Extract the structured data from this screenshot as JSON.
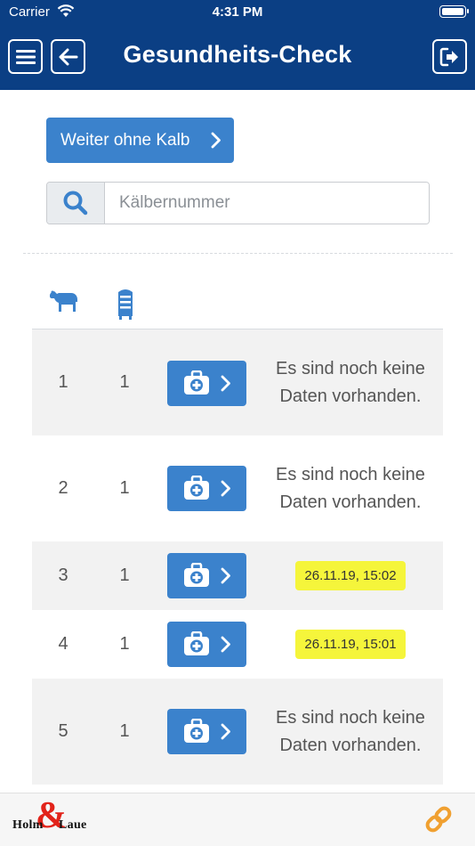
{
  "status_bar": {
    "carrier": "Carrier",
    "time": "4:31 PM"
  },
  "header": {
    "title": "Gesundheits-Check",
    "menu_icon": "hamburger-menu-icon",
    "back_icon": "arrow-left-icon",
    "logout_icon": "sign-out-icon"
  },
  "content": {
    "skip_button_label": "Weiter ohne Kalb",
    "search": {
      "placeholder": "Kälbernummer",
      "value": "",
      "icon": "search-icon"
    },
    "column_icons": [
      "cow-icon",
      "milk-tank-icon"
    ]
  },
  "rows": [
    {
      "col_a": "1",
      "col_b": "1",
      "status": "Es sind noch keine Daten vorhanden.",
      "date": ""
    },
    {
      "col_a": "2",
      "col_b": "1",
      "status": "Es sind noch keine Daten vorhanden.",
      "date": ""
    },
    {
      "col_a": "3",
      "col_b": "1",
      "status": "",
      "date": "26.11.19, 15:02"
    },
    {
      "col_a": "4",
      "col_b": "1",
      "status": "",
      "date": "26.11.19, 15:01"
    },
    {
      "col_a": "5",
      "col_b": "1",
      "status": "Es sind noch keine Daten vorhanden.",
      "date": ""
    }
  ],
  "footer": {
    "brand_left": "Holm",
    "brand_amp": "&",
    "brand_right": "Laue",
    "link_icon": "link-icon"
  },
  "colors": {
    "header_bg": "#0b3f84",
    "primary_button": "#3b82cc",
    "date_badge": "#f5f53b",
    "link_icon": "#f0a030",
    "brand_red": "#e2231a"
  }
}
